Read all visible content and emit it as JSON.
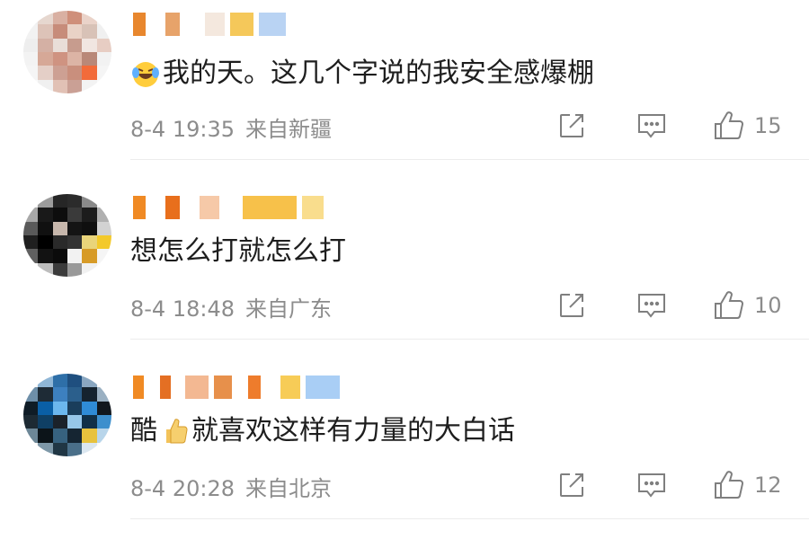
{
  "comments": [
    {
      "text": "我的天。这几个字说的我安全感爆棚",
      "leading_emoji": "laughing-crying-emoji",
      "time": "8-4 19:35",
      "location": "来自新疆",
      "likes": "15"
    },
    {
      "text": "想怎么打就怎么打",
      "time": "8-4 18:48",
      "location": "来自广东",
      "likes": "10"
    },
    {
      "text_before": "酷",
      "inline_emoji": "thumbs-up-emoji",
      "text_after": "就喜欢这样有力量的大白话",
      "time": "8-4 20:28",
      "location": "来自北京",
      "likes": "12"
    }
  ],
  "icons": {
    "forward": "share-icon",
    "reply": "comment-icon",
    "like": "thumbs-up-icon"
  },
  "colors": {
    "meta_text": "#8c8c8c",
    "icon_stroke": "#7f7f7f",
    "username_orange": "#f08a24",
    "username_blue": "#77b6ff"
  }
}
